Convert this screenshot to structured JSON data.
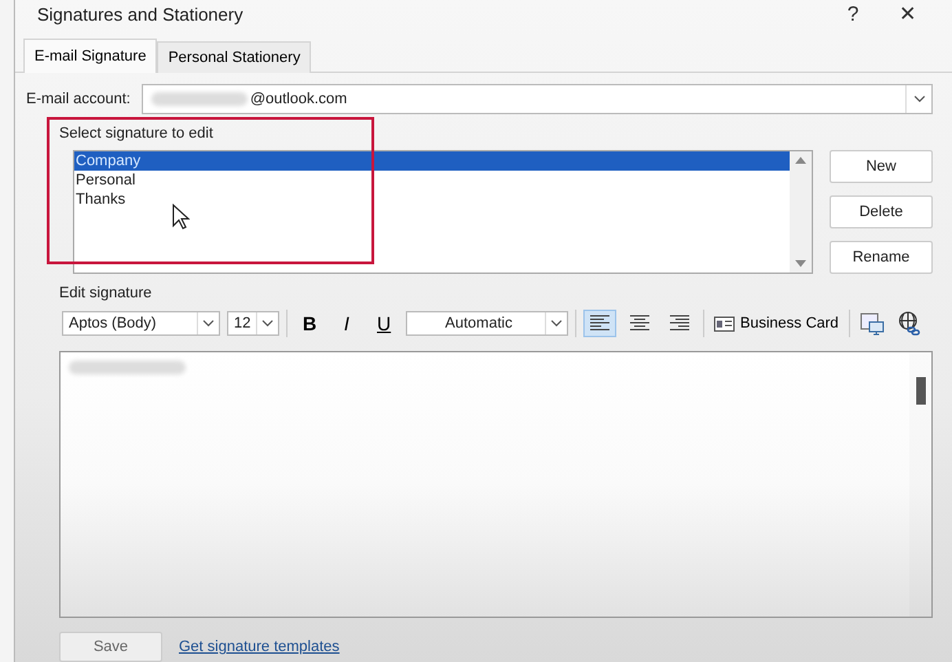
{
  "window": {
    "title": "Signatures and Stationery",
    "help": "?",
    "close": "✕"
  },
  "tabs": [
    {
      "label": "E-mail Signature",
      "selected": true
    },
    {
      "label": "Personal Stationery",
      "selected": false
    }
  ],
  "account": {
    "label": "E-mail account:",
    "value": "@outlook.com"
  },
  "select_group": {
    "label": "Select signature to edit",
    "signatures": [
      {
        "label": "Company",
        "selected": true
      },
      {
        "label": "Personal",
        "selected": false
      },
      {
        "label": "Thanks",
        "selected": false
      }
    ],
    "buttons": [
      "New",
      "Delete",
      "Rename"
    ]
  },
  "edit_group": {
    "label": "Edit signature",
    "font": "Aptos (Body)",
    "size": "12",
    "styles": [
      {
        "kind": "bold",
        "label": "B"
      },
      {
        "kind": "italic",
        "label": "I"
      },
      {
        "kind": "underline",
        "label": "U"
      }
    ],
    "font_color": "Automatic",
    "align": [
      {
        "kind": "left",
        "selected": true
      },
      {
        "kind": "center",
        "selected": false
      },
      {
        "kind": "right",
        "selected": false
      }
    ],
    "business_card": "Business Card"
  },
  "save": {
    "label": "Save",
    "disabled": true
  },
  "templates_link": "Get signature templates"
}
